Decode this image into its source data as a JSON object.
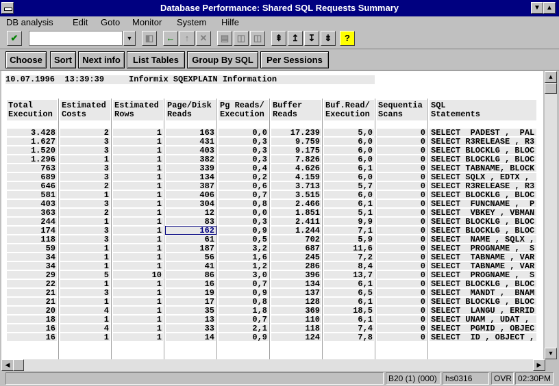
{
  "window": {
    "title": "Database Performance: Shared SQL Requests Summary",
    "min_glyph": "▼",
    "max_glyph": "▲"
  },
  "menu": [
    "DB analysis",
    "Edit",
    "Goto",
    "Monitor",
    "System",
    "Hilfe"
  ],
  "toolbar": {
    "command_value": "",
    "icons": [
      "check-icon",
      "dropdown-icon",
      "save-icon",
      "back-icon",
      "exit-icon",
      "cancel-icon",
      "print-icon",
      "find-icon",
      "find-next-icon",
      "first-page-icon",
      "prev-page-icon",
      "next-page-icon",
      "last-page-icon",
      "help-icon"
    ]
  },
  "app_buttons": [
    "Choose",
    "Sort",
    "Next info",
    "List Tables",
    "Group By SQL",
    "Per Sessions"
  ],
  "info_line": "10.07.1996  13:39:39     Informix SQEXPLAIN Information",
  "columns": [
    [
      "Total",
      "Execution"
    ],
    [
      "Estimated",
      "Costs"
    ],
    [
      "Estimated",
      "Rows"
    ],
    [
      "Page/Disk",
      "Reads"
    ],
    [
      "Pg Reads/",
      "Execution"
    ],
    [
      "Buffer",
      "Reads"
    ],
    [
      "Buf.Read/",
      "Execution"
    ],
    [
      "Sequentia",
      "Scans"
    ],
    [
      "SQL",
      "Statements"
    ]
  ],
  "rows": [
    [
      "3.428",
      "2",
      "1",
      "163",
      "0,0",
      "17.239",
      "5,0",
      "0",
      "SELECT  PADEST ,  PAL"
    ],
    [
      "1.627",
      "3",
      "1",
      "431",
      "0,3",
      "9.759",
      "6,0",
      "0",
      "SELECT R3RELEASE , R3"
    ],
    [
      "1.520",
      "3",
      "1",
      "403",
      "0,3",
      "9.175",
      "6,0",
      "0",
      "SELECT BLOCKLG , BLOC"
    ],
    [
      "1.296",
      "1",
      "1",
      "382",
      "0,3",
      "7.826",
      "6,0",
      "0",
      "SELECT BLOCKLG , BLOC"
    ],
    [
      "763",
      "3",
      "1",
      "339",
      "0,4",
      "4.626",
      "6,1",
      "0",
      "SELECT TABNAME, BLOCK"
    ],
    [
      "689",
      "3",
      "1",
      "134",
      "0,2",
      "4.159",
      "6,0",
      "0",
      "SELECT SQLX , EDTX ,"
    ],
    [
      "646",
      "2",
      "1",
      "387",
      "0,6",
      "3.713",
      "5,7",
      "0",
      "SELECT R3RELEASE , R3"
    ],
    [
      "581",
      "1",
      "1",
      "406",
      "0,7",
      "3.515",
      "6,0",
      "0",
      "SELECT BLOCKLG , BLOC"
    ],
    [
      "403",
      "3",
      "1",
      "304",
      "0,8",
      "2.466",
      "6,1",
      "0",
      "SELECT  FUNCNAME ,  P"
    ],
    [
      "363",
      "2",
      "1",
      "12",
      "0,0",
      "1.851",
      "5,1",
      "0",
      "SELECT  VBKEY , VBMAN"
    ],
    [
      "244",
      "1",
      "1",
      "83",
      "0,3",
      "2.411",
      "9,9",
      "0",
      "SELECT BLOCKLG , BLOC"
    ],
    [
      "174",
      "3",
      "1",
      "162",
      "0,9",
      "1.244",
      "7,1",
      "0",
      "SELECT BLOCKLG , BLOC"
    ],
    [
      "118",
      "3",
      "1",
      "61",
      "0,5",
      "702",
      "5,9",
      "0",
      "SELECT  NAME , SQLX ,"
    ],
    [
      "59",
      "1",
      "1",
      "187",
      "3,2",
      "687",
      "11,6",
      "0",
      "SELECT  PROGNAME ,  S"
    ],
    [
      "34",
      "1",
      "1",
      "56",
      "1,6",
      "245",
      "7,2",
      "0",
      "SELECT  TABNAME , VAR"
    ],
    [
      "34",
      "1",
      "1",
      "41",
      "1,2",
      "286",
      "8,4",
      "0",
      "SELECT  TABNAME , VAR"
    ],
    [
      "29",
      "5",
      "10",
      "86",
      "3,0",
      "396",
      "13,7",
      "0",
      "SELECT  PROGNAME ,  S"
    ],
    [
      "22",
      "1",
      "1",
      "16",
      "0,7",
      "134",
      "6,1",
      "0",
      "SELECT BLOCKLG , BLOC"
    ],
    [
      "21",
      "3",
      "1",
      "19",
      "0,9",
      "137",
      "6,5",
      "0",
      "SELECT  MANDT ,  BNAM"
    ],
    [
      "21",
      "1",
      "1",
      "17",
      "0,8",
      "128",
      "6,1",
      "0",
      "SELECT BLOCKLG , BLOC"
    ],
    [
      "20",
      "4",
      "1",
      "35",
      "1,8",
      "369",
      "18,5",
      "0",
      "SELECT  LANGU , ERRID"
    ],
    [
      "18",
      "1",
      "1",
      "13",
      "0,7",
      "110",
      "6,1",
      "0",
      "SELECT UNAM , UDAT ,"
    ],
    [
      "16",
      "4",
      "1",
      "33",
      "2,1",
      "118",
      "7,4",
      "0",
      "SELECT  PGMID , OBJEC"
    ],
    [
      "16",
      "1",
      "1",
      "14",
      "0,9",
      "124",
      "7,8",
      "0",
      "SELECT  ID , OBJECT ,"
    ]
  ],
  "status": {
    "system": "B20 (1) (000)",
    "server": "hs0316",
    "mode": "OVR",
    "time": "02:30PM"
  }
}
